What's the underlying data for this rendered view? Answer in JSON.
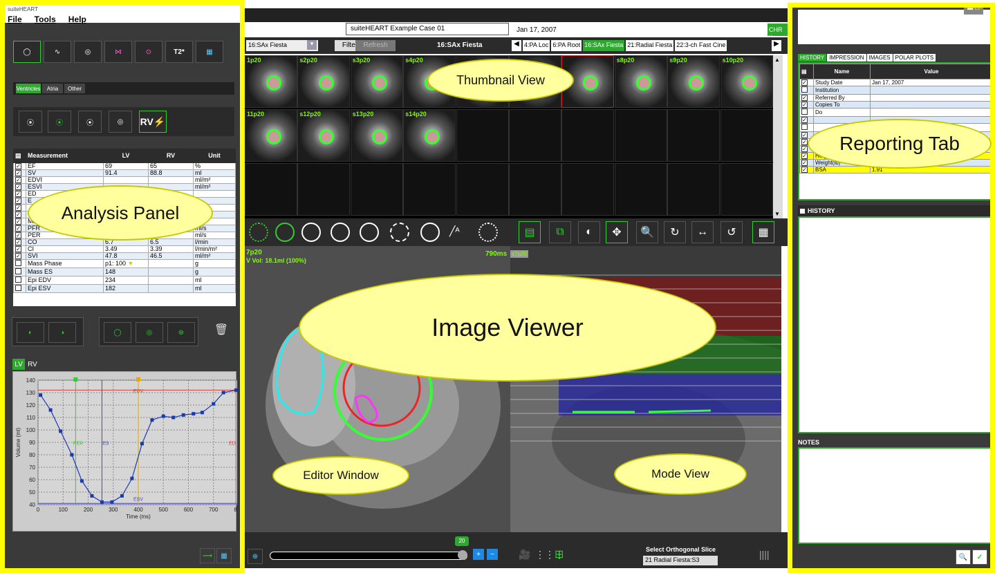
{
  "app_title": "suiteHEART",
  "menu": [
    "File",
    "Tools",
    "Help"
  ],
  "case_name": "suiteHEART Example Case 01",
  "study_date_top": "Jan 17, 2007",
  "chr_badge": "CHR v.",
  "series_select": "16:SAx Fiesta",
  "filter_label": "Filter",
  "refresh_label": "Refresh",
  "current_series": "16:SAx Fiesta",
  "series_tabs": [
    "4:PA Loc",
    "6:PA Root",
    "16:SAx Fiesta",
    "21:Radial Fiesta",
    "22:3-ch Fast Cine"
  ],
  "analysis_tabs": [
    "Ventricles",
    "Atria",
    "Other"
  ],
  "rv_label": "RV",
  "meas_headers": [
    "Measurement",
    "LV",
    "RV",
    "Unit"
  ],
  "meas_rows": [
    {
      "name": "EF",
      "lv": "69",
      "rv": "65",
      "unit": "%",
      "checked": true
    },
    {
      "name": "SV",
      "lv": "91.4",
      "rv": "88.8",
      "unit": "ml",
      "checked": true
    },
    {
      "name": "EDVI",
      "lv": "",
      "rv": "",
      "unit": "ml/m²",
      "checked": true
    },
    {
      "name": "ESVI",
      "lv": "",
      "rv": "",
      "unit": "ml/m²",
      "checked": true
    },
    {
      "name": "ED",
      "lv": "",
      "rv": "",
      "unit": "",
      "checked": true
    },
    {
      "name": "E",
      "lv": "",
      "rv": "",
      "unit": "",
      "checked": true
    },
    {
      "name": "",
      "lv": "",
      "rv": "",
      "unit": "",
      "checked": true
    },
    {
      "name": "",
      "lv": "",
      "rv": "",
      "unit": "",
      "checked": true
    },
    {
      "name": "Mas",
      "lv": "",
      "rv": "",
      "unit": "",
      "checked": true
    },
    {
      "name": "PFR",
      "lv": "",
      "rv": "",
      "unit": "ml/s",
      "checked": true
    },
    {
      "name": "PER",
      "lv": "",
      "rv": "",
      "unit": "ml/s",
      "checked": true
    },
    {
      "name": "CO",
      "lv": "6.7",
      "rv": "6.5",
      "unit": "l/min",
      "checked": true
    },
    {
      "name": "CI",
      "lv": "3.49",
      "rv": "3.39",
      "unit": "l/min/m²",
      "checked": true
    },
    {
      "name": "SVI",
      "lv": "47.8",
      "rv": "46.5",
      "unit": "ml/m²",
      "checked": true
    },
    {
      "name": "Mass Phase",
      "lv": "p1: 100",
      "rv": "",
      "unit": "g",
      "checked": false
    },
    {
      "name": "Mass ES",
      "lv": "148",
      "rv": "",
      "unit": "g",
      "checked": false
    },
    {
      "name": "Epi EDV",
      "lv": "234",
      "rv": "",
      "unit": "ml",
      "checked": false
    },
    {
      "name": "Epi ESV",
      "lv": "182",
      "rv": "",
      "unit": "ml",
      "checked": false
    }
  ],
  "graph_tabs": [
    "LV",
    "RV"
  ],
  "chart_data": {
    "type": "line",
    "xlabel": "Time (ms)",
    "ylabel": "Volume (ml)",
    "xlim": [
      0,
      800
    ],
    "ylim": [
      40,
      140
    ],
    "xticks": [
      0,
      100,
      200,
      300,
      400,
      500,
      600,
      700,
      800
    ],
    "yticks": [
      40,
      50,
      60,
      70,
      80,
      90,
      100,
      110,
      120,
      130,
      140
    ],
    "x": [
      10,
      50,
      90,
      135,
      175,
      215,
      255,
      295,
      335,
      375,
      415,
      455,
      500,
      540,
      580,
      620,
      655,
      700,
      740,
      790
    ],
    "y": [
      128,
      116,
      99,
      80,
      59,
      47,
      42,
      42,
      47,
      61,
      89,
      108,
      111,
      110,
      112,
      113,
      114,
      121,
      130,
      132
    ],
    "annotations": [
      "EDV",
      "ESV",
      "PER",
      "ES",
      "ED"
    ],
    "grid": true
  },
  "thumb_labels": [
    "1p20",
    "s2p20",
    "s3p20",
    "s4p20",
    "",
    "",
    "",
    "s8p20",
    "s9p20",
    "s10p20",
    "11p20",
    "s12p20",
    "s13p20",
    "s14p20"
  ],
  "viewer_slice": "7p20",
  "viewer_vol": "V Vol: 18.1ml (100%)",
  "viewer_time": "790ms",
  "viewer_tag": "s7p20",
  "slider_value": "20",
  "orth_label": "Select Orthogonal Slice",
  "orth_value": "21 Radial Fiesta:S3",
  "report_tabs": [
    "HISTORY",
    "IMPRESSION",
    "IMAGES",
    "POLAR PLOTS"
  ],
  "report_headers": [
    "Name",
    "Value"
  ],
  "report_rows": [
    {
      "name": "Study Date",
      "value": "Jan 17, 2007",
      "checked": true,
      "hl": false
    },
    {
      "name": "Institution",
      "value": "",
      "checked": false,
      "hl": false
    },
    {
      "name": "Referred By",
      "value": "",
      "checked": true,
      "hl": false
    },
    {
      "name": "Copies To",
      "value": "",
      "checked": true,
      "hl": false
    },
    {
      "name": "Do",
      "value": "",
      "checked": false,
      "hl": false
    },
    {
      "name": "",
      "value": "",
      "checked": true,
      "hl": false
    },
    {
      "name": "",
      "value": "",
      "checked": false,
      "hl": false
    },
    {
      "name": "",
      "value": "",
      "checked": true,
      "hl": false
    },
    {
      "name": "",
      "value": "",
      "checked": true,
      "hl": false
    },
    {
      "name": "",
      "value": "",
      "checked": true,
      "hl": false
    },
    {
      "name": "Height(in)",
      "value": "",
      "checked": true,
      "hl": true
    },
    {
      "name": "Weight(lb)",
      "value": "195",
      "checked": true,
      "hl": false
    },
    {
      "name": "BSA",
      "value": "1.91",
      "checked": true,
      "hl": true
    }
  ],
  "history_label": "HISTORY",
  "notes_label": "NOTES",
  "callouts": {
    "thumbnail": "Thumbnail View",
    "reporting": "Reporting Tab",
    "analysis": "Analysis Panel",
    "viewer": "Image Viewer",
    "editor": "Editor Window",
    "mode": "Mode View"
  }
}
